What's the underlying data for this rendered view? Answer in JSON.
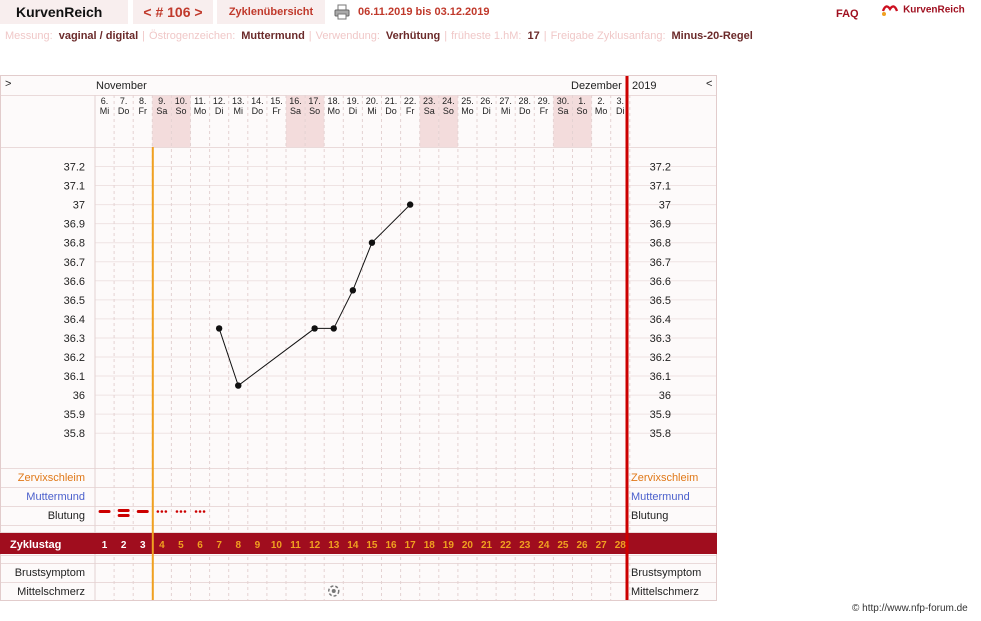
{
  "header": {
    "brand": "KurvenReich",
    "cycle_number": "< # 106 >",
    "overview_tab": "Zyklenübersicht",
    "date_range": "06.11.2019 bis 03.12.2019",
    "faq": "FAQ",
    "logo_text": "KurvenReich"
  },
  "settings": [
    {
      "label": "Messung:",
      "value": "vaginal / digital"
    },
    {
      "label": "Östrogenzeichen:",
      "value": "Muttermund"
    },
    {
      "label": "Verwendung:",
      "value": "Verhütung"
    },
    {
      "label": "früheste 1.hM:",
      "value": "17"
    },
    {
      "label": "Freigabe Zyklusanfang:",
      "value": "Minus-20-Regel"
    }
  ],
  "nav": {
    "prev": ">",
    "next": "<"
  },
  "months": {
    "first": "November",
    "second": "Dezember",
    "year": "2019"
  },
  "copyright": "© http://www.nfp-forum.de",
  "colors": {
    "accent": "#a00d1e",
    "cycle_day_text": "#f0a020",
    "orange_line": "#f0a020",
    "red_line": "#cc0000",
    "weekend_bg": "#f3dcdc"
  },
  "chart_data": {
    "type": "line",
    "title": "",
    "days": [
      {
        "date": "6.",
        "weekday": "Mi",
        "cycle_day": 1
      },
      {
        "date": "7.",
        "weekday": "Do",
        "cycle_day": 2
      },
      {
        "date": "8.",
        "weekday": "Fr",
        "cycle_day": 3
      },
      {
        "date": "9.",
        "weekday": "Sa",
        "cycle_day": 4
      },
      {
        "date": "10.",
        "weekday": "So",
        "cycle_day": 5
      },
      {
        "date": "11.",
        "weekday": "Mo",
        "cycle_day": 6
      },
      {
        "date": "12.",
        "weekday": "Di",
        "cycle_day": 7
      },
      {
        "date": "13.",
        "weekday": "Mi",
        "cycle_day": 8
      },
      {
        "date": "14.",
        "weekday": "Do",
        "cycle_day": 9
      },
      {
        "date": "15.",
        "weekday": "Fr",
        "cycle_day": 10
      },
      {
        "date": "16.",
        "weekday": "Sa",
        "cycle_day": 11
      },
      {
        "date": "17.",
        "weekday": "So",
        "cycle_day": 12
      },
      {
        "date": "18.",
        "weekday": "Mo",
        "cycle_day": 13
      },
      {
        "date": "19.",
        "weekday": "Di",
        "cycle_day": 14
      },
      {
        "date": "20.",
        "weekday": "Mi",
        "cycle_day": 15
      },
      {
        "date": "21.",
        "weekday": "Do",
        "cycle_day": 16
      },
      {
        "date": "22.",
        "weekday": "Fr",
        "cycle_day": 17
      },
      {
        "date": "23.",
        "weekday": "Sa",
        "cycle_day": 18
      },
      {
        "date": "24.",
        "weekday": "So",
        "cycle_day": 19
      },
      {
        "date": "25.",
        "weekday": "Mo",
        "cycle_day": 20
      },
      {
        "date": "26.",
        "weekday": "Di",
        "cycle_day": 21
      },
      {
        "date": "27.",
        "weekday": "Mi",
        "cycle_day": 22
      },
      {
        "date": "28.",
        "weekday": "Do",
        "cycle_day": 23
      },
      {
        "date": "29.",
        "weekday": "Fr",
        "cycle_day": 24
      },
      {
        "date": "30.",
        "weekday": "Sa",
        "cycle_day": 25
      },
      {
        "date": "1.",
        "weekday": "So",
        "cycle_day": 26
      },
      {
        "date": "2.",
        "weekday": "Mo",
        "cycle_day": 27
      },
      {
        "date": "3.",
        "weekday": "Di",
        "cycle_day": 28
      }
    ],
    "weekend_day_indices": [
      3,
      4,
      10,
      11,
      17,
      18,
      24,
      25
    ],
    "y_ticks": [
      "37.2",
      "37.1",
      "37",
      "36.9",
      "36.8",
      "36.7",
      "36.6",
      "36.5",
      "36.4",
      "36.3",
      "36.2",
      "36.1",
      "36",
      "35.9",
      "35.8"
    ],
    "ylim": [
      35.8,
      37.2
    ],
    "temperatures": [
      {
        "cycle_day": 7,
        "value": 36.35
      },
      {
        "cycle_day": 8,
        "value": 36.05
      },
      {
        "cycle_day": 12,
        "value": 36.35
      },
      {
        "cycle_day": 13,
        "value": 36.35
      },
      {
        "cycle_day": 14,
        "value": 36.55
      },
      {
        "cycle_day": 15,
        "value": 36.8
      },
      {
        "cycle_day": 17,
        "value": 37.0
      }
    ],
    "bleeding": [
      {
        "cycle_day": 1,
        "level": "strong"
      },
      {
        "cycle_day": 2,
        "level": "strong"
      },
      {
        "cycle_day": 3,
        "level": "strong"
      },
      {
        "cycle_day": 4,
        "level": "spotting"
      },
      {
        "cycle_day": 5,
        "level": "spotting"
      },
      {
        "cycle_day": 6,
        "level": "spotting"
      }
    ],
    "pain_marker": {
      "cycle_day": 13,
      "row": "Mittelschmerz",
      "icon": "mittelschmerz-icon"
    },
    "cycle_start_marker_after_day": 3,
    "rows": {
      "cervical_mucus": "Zervixschleim",
      "cervix": "Muttermund",
      "bleeding": "Blutung",
      "cycle_day": "Zyklustag",
      "breast": "Brustsymptom",
      "mittelschmerz": "Mittelschmerz"
    }
  }
}
